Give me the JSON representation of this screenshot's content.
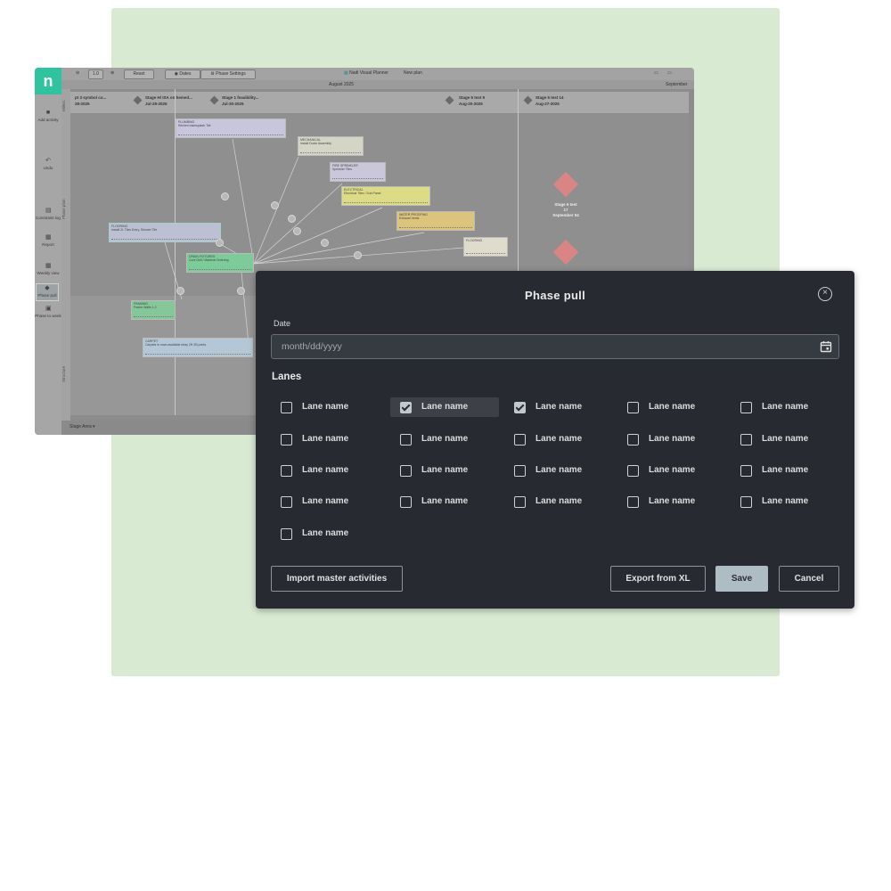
{
  "background_app": {
    "logo": "n",
    "toolbar": {
      "zoom": "1.0",
      "reset": "Reset",
      "dates": "Dates",
      "phase_settings": "Phase Settings",
      "app_name": "Nadi Visual Planner",
      "plan_name": "New plan"
    },
    "month_label": "August 2025",
    "next_month_label": "September",
    "sidebar": [
      {
        "label": "Add activity",
        "icon": "square-icon"
      },
      {
        "label": "Undo",
        "icon": "undo-icon"
      },
      {
        "label": "Constraint log",
        "icon": "log-icon"
      },
      {
        "label": "Report",
        "icon": "report-icon"
      },
      {
        "label": "Weekly view",
        "icon": "grid-icon"
      },
      {
        "label": "Phase pull",
        "icon": "diamond-icon"
      },
      {
        "label": "Phase to week",
        "icon": "week-icon"
      }
    ],
    "lane_labels": [
      "Milest.",
      "Phase plan",
      "Structure"
    ],
    "milestones": [
      {
        "name": "pt 3 symbol co...",
        "date": "28-2025"
      },
      {
        "name": "Stage H/ ISA on hemed...",
        "date": "Jul-29-2025"
      },
      {
        "name": "Stage 1 feasibility...",
        "date": "Jul-30-2025"
      },
      {
        "name": "Stage 5 test 9",
        "date": "Aug-20-2025"
      },
      {
        "name": "Stage 5 test 14",
        "date": "Aug-27-2025"
      }
    ],
    "cards": [
      {
        "title": "PLUMBING",
        "sub": "Kitchen backsplash Tile",
        "color": "#c8c6dc"
      },
      {
        "title": "MECHANICAL",
        "sub": "Install Ducts Assembly",
        "color": "#d5d5c5"
      },
      {
        "title": "FIRE SPRINKLER",
        "sub": "Sprinkler Tiles",
        "color": "#c9c7d9"
      },
      {
        "title": "ELECTRICAL",
        "sub": "Electrical Tiles / Sub Panel",
        "color": "#dcdc86"
      },
      {
        "title": "WATER PROOFING",
        "sub": "Exhaust Vents",
        "color": "#dcc47c"
      },
      {
        "title": "FLOORING",
        "sub": "",
        "color": "#e0dccc"
      },
      {
        "title": "FLOORING",
        "sub": "Install 2L Tiles Entry, Shower Tile",
        "color": "#bcc0d2"
      },
      {
        "title": "DRAIN FIXTURES",
        "sub": "Core Drill / Material Ordering",
        "color": "#7ecb9a"
      },
      {
        "title": "FRAMING",
        "sub": "Frame Walls 1-2",
        "color": "#86c79a"
      },
      {
        "title": "CARPET",
        "sub": "Carpets in main available relay 2H 2B prints",
        "color": "#b4c7d6"
      }
    ],
    "stage_marker": {
      "line1": "Stage 5 test",
      "line2": "17",
      "line3": "September 04"
    },
    "stage_area": "Stage Area"
  },
  "modal": {
    "title": "Phase pull",
    "date_label": "Date",
    "date_placeholder": "month/dd/yyyy",
    "lanes_title": "Lanes",
    "lanes": [
      {
        "label": "Lane name",
        "checked": false,
        "selected": false
      },
      {
        "label": "Lane name",
        "checked": true,
        "selected": true
      },
      {
        "label": "Lane name",
        "checked": true,
        "selected": false
      },
      {
        "label": "Lane name",
        "checked": false,
        "selected": false
      },
      {
        "label": "Lane name",
        "checked": false,
        "selected": false
      },
      {
        "label": "Lane name",
        "checked": false,
        "selected": false
      },
      {
        "label": "Lane name",
        "checked": false,
        "selected": false
      },
      {
        "label": "Lane name",
        "checked": false,
        "selected": false
      },
      {
        "label": "Lane name",
        "checked": false,
        "selected": false
      },
      {
        "label": "Lane name",
        "checked": false,
        "selected": false
      },
      {
        "label": "Lane name",
        "checked": false,
        "selected": false
      },
      {
        "label": "Lane name",
        "checked": false,
        "selected": false
      },
      {
        "label": "Lane name",
        "checked": false,
        "selected": false
      },
      {
        "label": "Lane name",
        "checked": false,
        "selected": false
      },
      {
        "label": "Lane name",
        "checked": false,
        "selected": false
      },
      {
        "label": "Lane name",
        "checked": false,
        "selected": false
      },
      {
        "label": "Lane name",
        "checked": false,
        "selected": false
      },
      {
        "label": "Lane name",
        "checked": false,
        "selected": false
      },
      {
        "label": "Lane name",
        "checked": false,
        "selected": false
      },
      {
        "label": "Lane name",
        "checked": false,
        "selected": false
      },
      {
        "label": "Lane name",
        "checked": false,
        "selected": false
      }
    ],
    "buttons": {
      "import": "Import master activities",
      "export": "Export from XL",
      "save": "Save",
      "cancel": "Cancel"
    }
  },
  "colors": {
    "page_bg": "#ffffff",
    "green_panel": "#d9ead3",
    "modal_bg": "#272a30",
    "save_button": "#aebcc4",
    "brand_teal": "#2ec4a0",
    "milestone_red": "#d98585"
  }
}
